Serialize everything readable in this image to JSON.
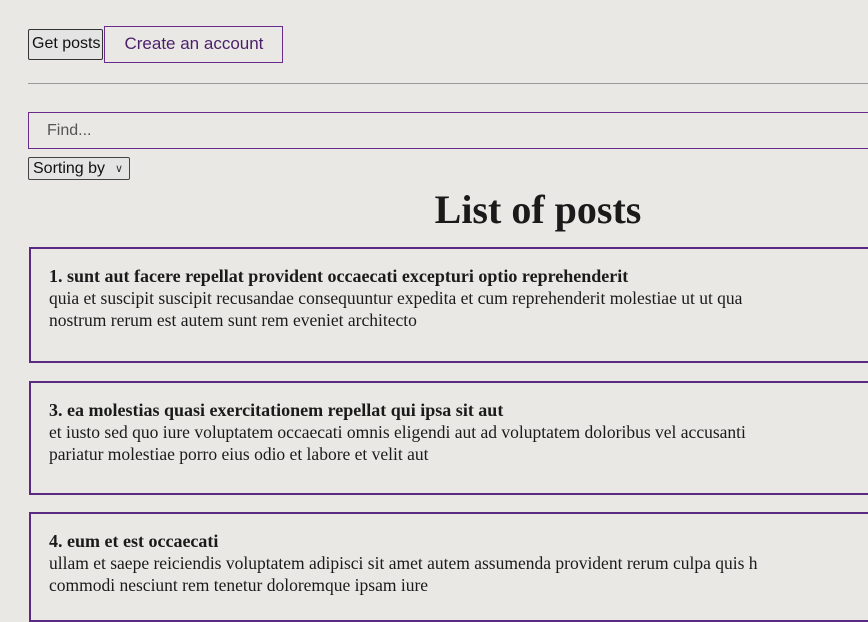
{
  "toolbar": {
    "get_posts_label": "Get posts",
    "create_account_label": "Create an account"
  },
  "search": {
    "placeholder": "Find..."
  },
  "sort": {
    "selected": "Sorting by"
  },
  "page_title": "List of posts",
  "posts": [
    {
      "title": "1. sunt aut facere repellat provident occaecati excepturi optio reprehenderit",
      "body_line1": "quia et suscipit suscipit recusandae consequuntur expedita et cum reprehenderit molestiae ut ut qua",
      "body_line2": "nostrum rerum est autem sunt rem eveniet architecto"
    },
    {
      "title": "3. ea molestias quasi exercitationem repellat qui ipsa sit aut",
      "body_line1": "et iusto sed quo iure voluptatem occaecati omnis eligendi aut ad voluptatem doloribus vel accusanti",
      "body_line2": "pariatur molestiae porro eius odio et labore et velit aut"
    },
    {
      "title": "4. eum et est occaecati",
      "body_line1": "ullam et saepe reiciendis voluptatem adipisci sit amet autem assumenda provident rerum culpa quis h",
      "body_line2": "commodi nesciunt rem tenetur doloremque ipsam iure"
    }
  ]
}
